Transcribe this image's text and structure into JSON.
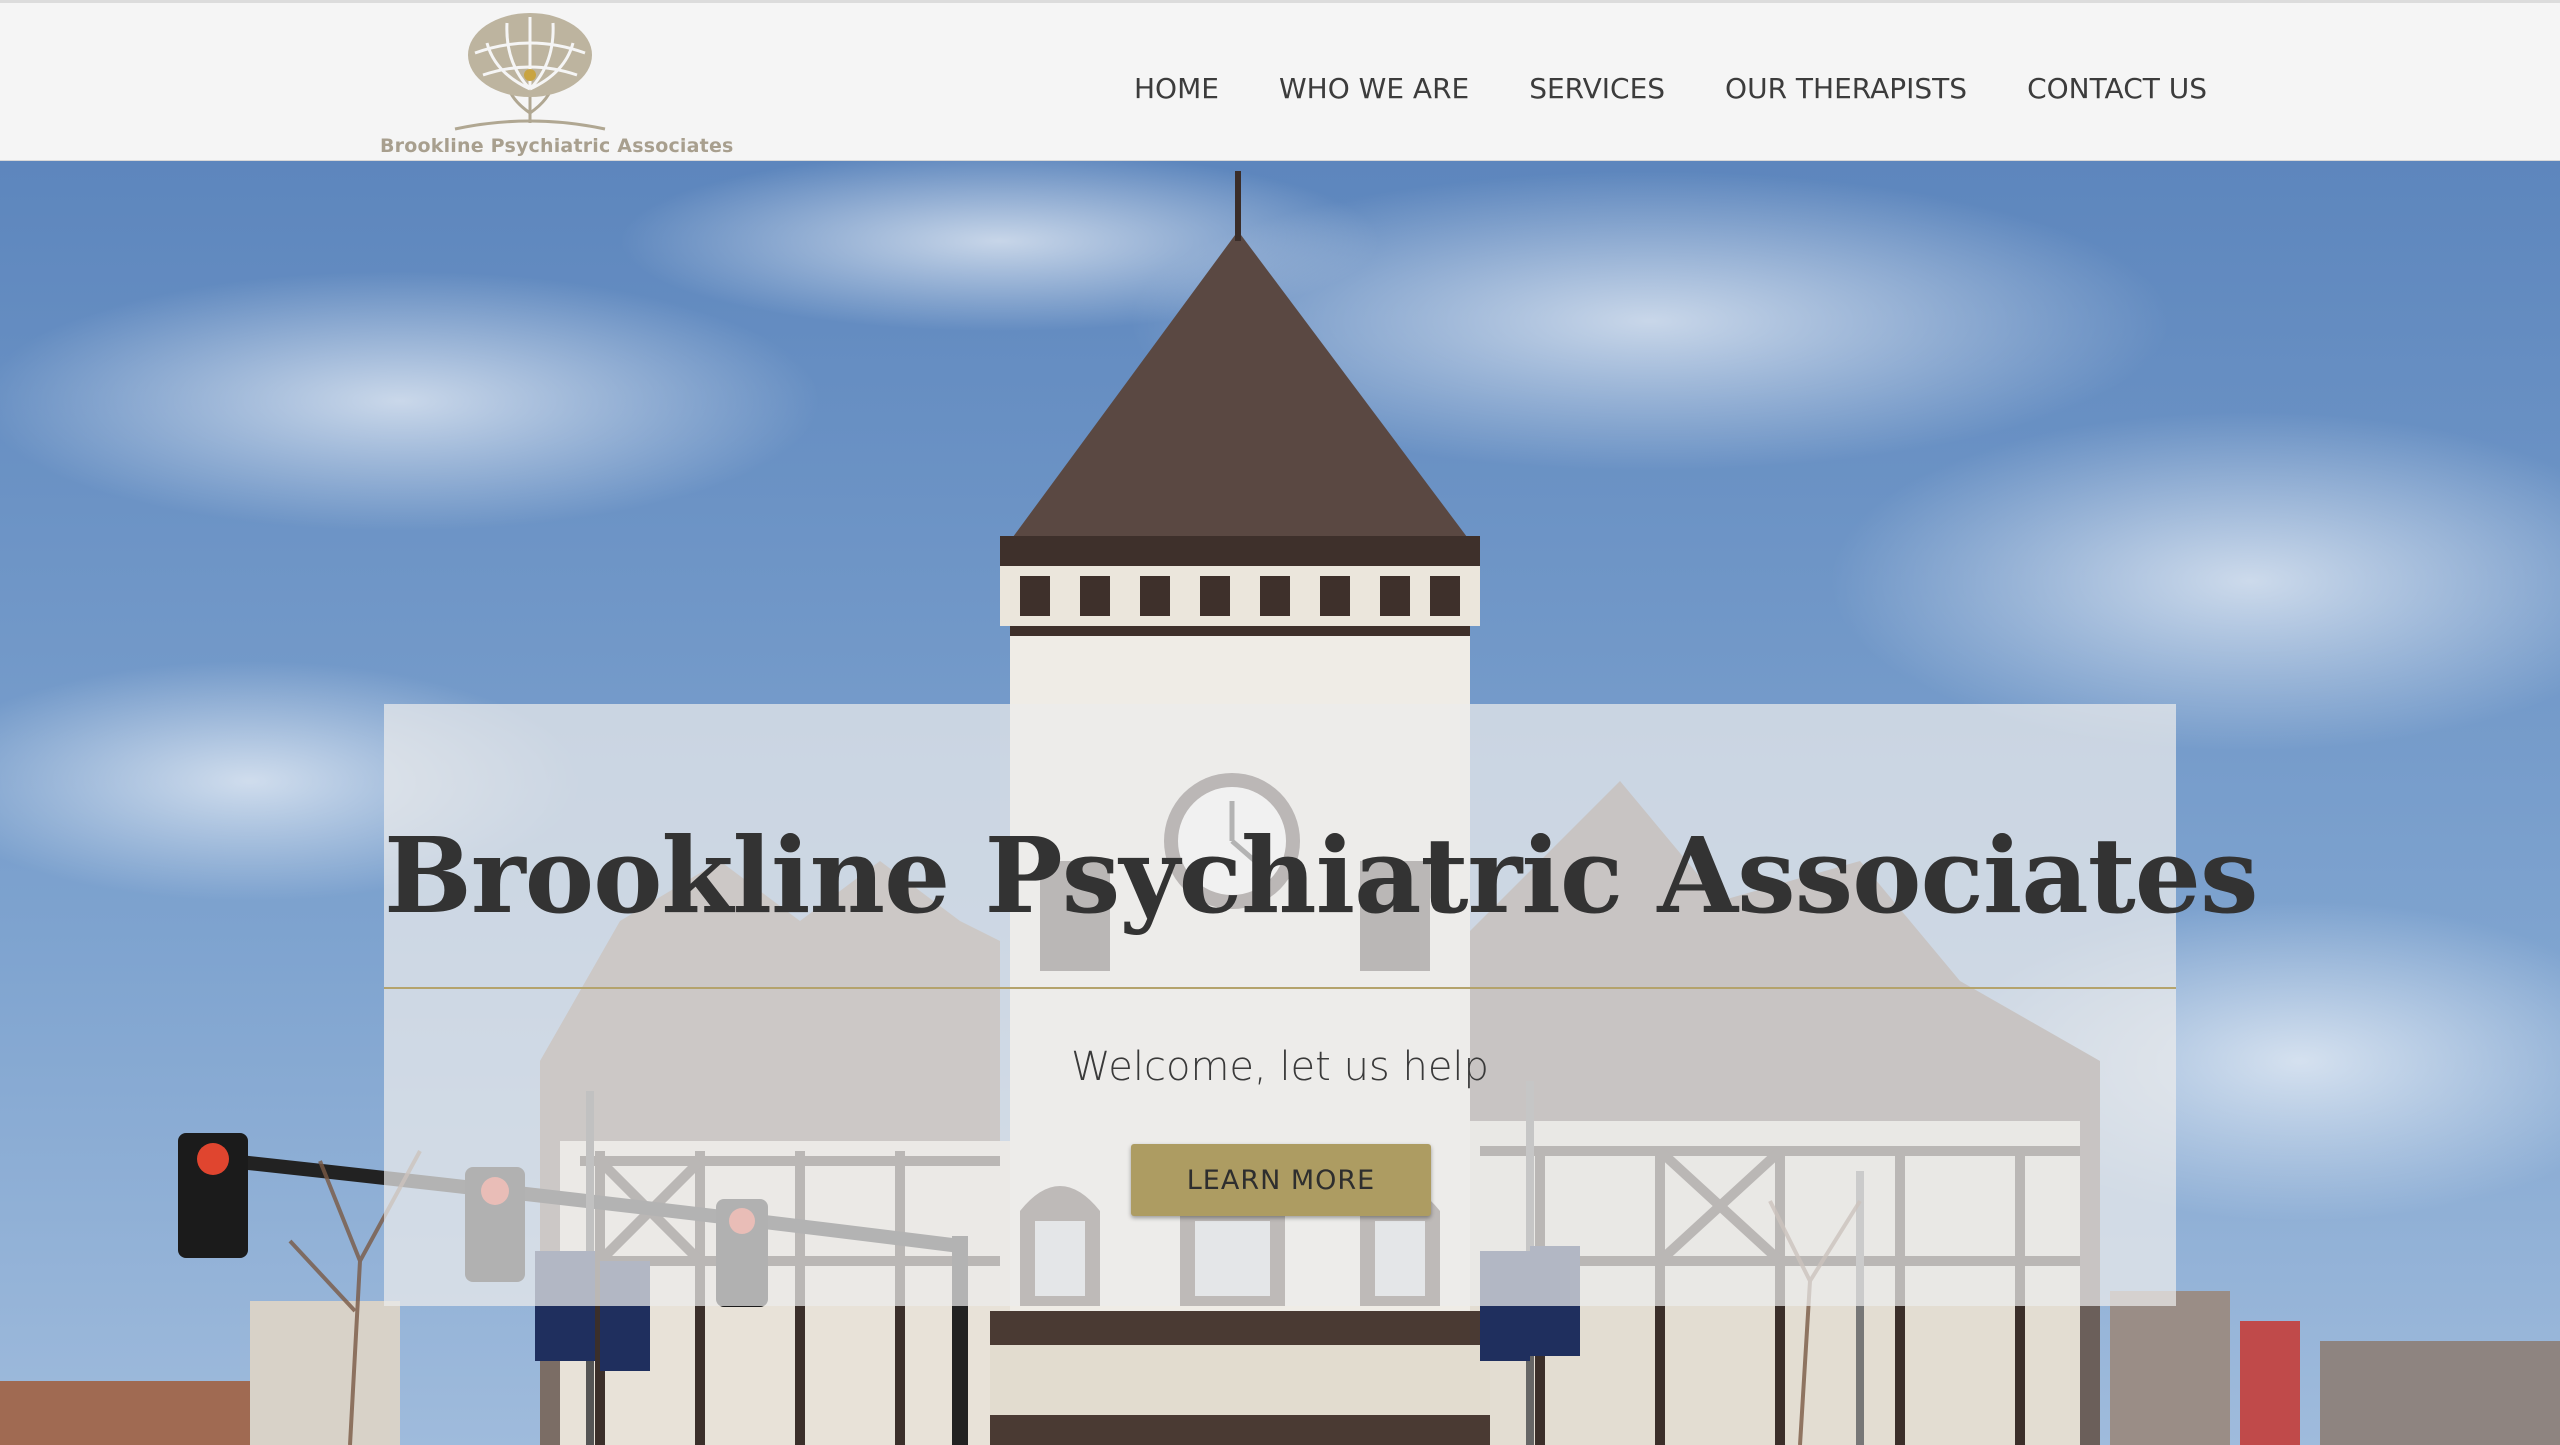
{
  "header": {
    "logo_text": "Brookline Psychiatric Associates",
    "nav": [
      {
        "label": "HOME"
      },
      {
        "label": "WHO WE ARE"
      },
      {
        "label": "SERVICES"
      },
      {
        "label": "OUR THERAPISTS"
      },
      {
        "label": "CONTACT US"
      }
    ]
  },
  "hero": {
    "title": "Brookline Psychiatric Associates",
    "subtitle": "Welcome, let us help",
    "cta_label": "LEARN MORE",
    "image_label": "brookline-building-photo"
  },
  "colors": {
    "accent": "#ad9c62",
    "header_bg": "#f5f5f5",
    "text_dark": "#333333",
    "sky": "#6f95c4"
  }
}
